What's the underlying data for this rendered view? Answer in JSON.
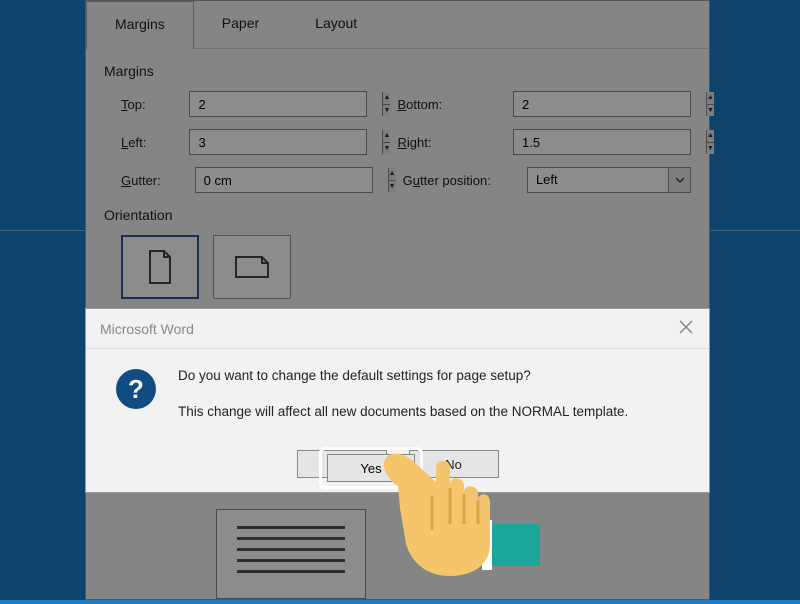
{
  "page_setup": {
    "tabs": [
      {
        "label": "Margins"
      },
      {
        "label": "Paper"
      },
      {
        "label": "Layout"
      }
    ],
    "section1_label": "Margins",
    "top_label": "Top:",
    "top_value": "2",
    "bottom_label": "Bottom:",
    "bottom_value": "2",
    "left_label": "Left:",
    "left_value": "3",
    "right_label": "Right:",
    "right_value": "1.5",
    "gutter_label": "Gutter:",
    "gutter_value": "0 cm",
    "gutter_pos_label": "Gutter position:",
    "gutter_pos_value": "Left",
    "orientation_label": "Orientation"
  },
  "dialog": {
    "title": "Microsoft Word",
    "line1": "Do you want to change the default settings for page setup?",
    "line2": "This change will affect all new documents based on the NORMAL template.",
    "yes": "Yes",
    "no": "No"
  }
}
